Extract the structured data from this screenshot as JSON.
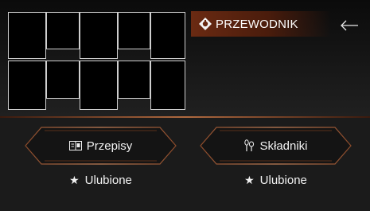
{
  "header": {
    "guide_label": "PRZEWODNIK",
    "back_icon": "arrow-left-icon",
    "guide_icon": "diamond-badge-icon"
  },
  "gallery": {
    "thumbnails": [
      "",
      "",
      "",
      "",
      "",
      "",
      "",
      "",
      "",
      ""
    ]
  },
  "buttons": {
    "recipes_label": "Przepisy",
    "recipes_icon": "recipe-book-icon",
    "ingredients_label": "Składniki",
    "ingredients_icon": "ingredients-icon"
  },
  "favorites": {
    "left_label": "Ulubione",
    "right_label": "Ulubione",
    "star_icon": "star-icon"
  },
  "colors": {
    "accent": "#b06a40",
    "accent_dark": "#6a2a12",
    "panel": "#1b1b1b",
    "background": "#000000"
  }
}
